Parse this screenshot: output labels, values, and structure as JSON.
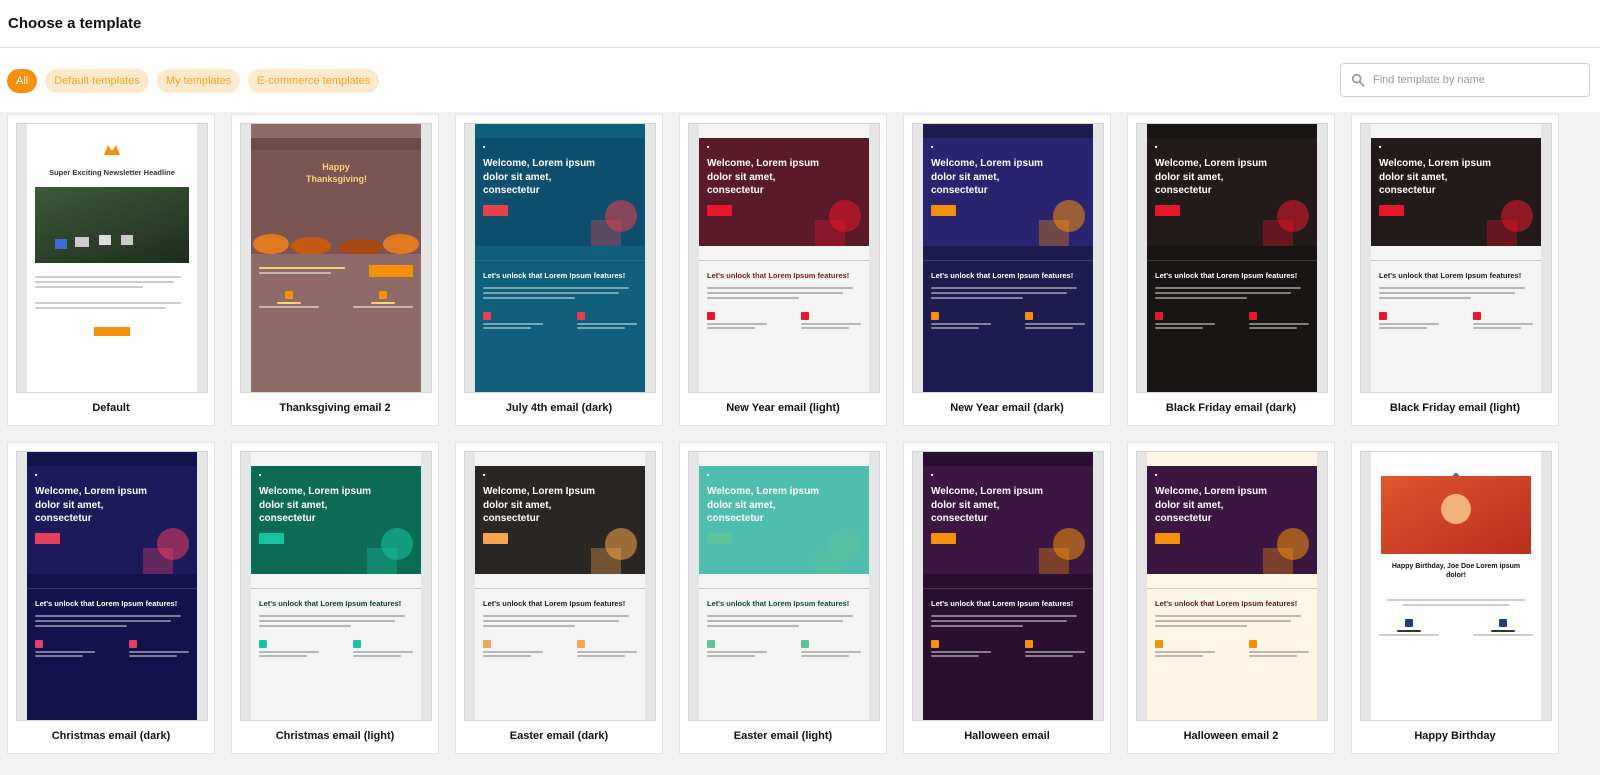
{
  "header": {
    "title": "Choose a template"
  },
  "filters": [
    {
      "label": "All",
      "active": true
    },
    {
      "label": "Default templates",
      "active": false
    },
    {
      "label": "My templates",
      "active": false
    },
    {
      "label": "E-commerce templates",
      "active": false
    }
  ],
  "search": {
    "placeholder": "Find template by name",
    "icon": "search-icon"
  },
  "templates": [
    {
      "name": "Default",
      "style": "default",
      "bg": "#ffffff",
      "hero": "#ffffff",
      "accent": "#f5900a",
      "heading": "Super Exciting Newsletter Headline",
      "text": "#333333"
    },
    {
      "name": "Thanksgiving email 2",
      "style": "thanks",
      "bg": "#8e6b69",
      "hero": "#7a5552",
      "accent": "#f5900a",
      "heading": "Happy Thanksgiving!",
      "text": "#ffd27a"
    },
    {
      "name": "July 4th email (dark)",
      "style": "holiday",
      "bg": "#0f5e7a",
      "hero": "#0f4f6e",
      "accent": "#e8404f",
      "heading": "Welcome, Lorem ipsum dolor sit amet, consectetur",
      "body_heading": "Let's unlock that Lorem Ipsum features!",
      "text": "#ffffff"
    },
    {
      "name": "New Year email (light)",
      "style": "holiday",
      "bg": "#f4f4f4",
      "hero": "#5a1a2a",
      "accent": "#e8172c",
      "heading": "Welcome, Lorem ipsum dolor sit amet, consectetur",
      "body_heading": "Let's unlock that Lorem Ipsum features!",
      "text": "#7a1a24"
    },
    {
      "name": "New Year email (dark)",
      "style": "holiday",
      "bg": "#1e1b4e",
      "hero": "#2a2470",
      "accent": "#f5900a",
      "heading": "Welcome, Lorem ipsum dolor sit amet, consectetur",
      "body_heading": "Let's unlock that Lorem Ipsum features!",
      "text": "#ffffff"
    },
    {
      "name": "Black Friday email (dark)",
      "style": "holiday",
      "bg": "#1a1515",
      "hero": "#231a1a",
      "accent": "#e8172c",
      "heading": "Welcome, Lorem ipsum dolor sit amet, consectetur",
      "body_heading": "Let's unlock that Lorem Ipsum features!",
      "text": "#ffffff"
    },
    {
      "name": "Black Friday email (light)",
      "style": "holiday",
      "bg": "#f4f4f4",
      "hero": "#231a1a",
      "accent": "#e8172c",
      "heading": "Welcome, Lorem ipsum dolor sit amet, consectetur",
      "body_heading": "Let's unlock that Lorem Ipsum features!",
      "text": "#222222"
    },
    {
      "name": "Christmas email (dark)",
      "style": "holiday",
      "bg": "#14124a",
      "hero": "#1d1a5c",
      "accent": "#e8405f",
      "heading": "Welcome, Lorem ipsum dolor sit amet, consectetur",
      "body_heading": "Let's unlock that Lorem Ipsum features!",
      "text": "#ffffff"
    },
    {
      "name": "Christmas email (light)",
      "style": "holiday",
      "bg": "#f4f4f4",
      "hero": "#0d6a55",
      "accent": "#19c2a2",
      "heading": "Welcome, Lorem ipsum dolor sit amet, consectetur",
      "body_heading": "Let's unlock that Lorem Ipsum features!",
      "text": "#0b3d34"
    },
    {
      "name": "Easter email (dark)",
      "style": "holiday",
      "bg": "#f4f4f4",
      "hero": "#2a2623",
      "accent": "#f5a54f",
      "heading": "Welcome, Lorem Ipsum dolor sit amet, consectetur",
      "body_heading": "Let's unlock that Lorem Ipsum features!",
      "text": "#222222"
    },
    {
      "name": "Easter email (light)",
      "style": "holiday",
      "bg": "#f4f4f4",
      "hero": "#4fbdb0",
      "accent": "#5fc39a",
      "heading": "Welcome, Lorem ipsum dolor sit amet, consectetur",
      "body_heading": "Let's unlock that Lorem Ipsum features!",
      "text": "#114a3f"
    },
    {
      "name": "Halloween email",
      "style": "holiday",
      "bg": "#2a0f30",
      "hero": "#3a1640",
      "accent": "#f5900a",
      "heading": "Welcome, Lorem ipsum dolor sit amet, consectetur",
      "body_heading": "Let's unlock that Lorem Ipsum features!",
      "text": "#ffffff"
    },
    {
      "name": "Halloween email 2",
      "style": "holiday",
      "bg": "#fdf5e6",
      "hero": "#3a1640",
      "accent": "#f5900a",
      "heading": "Welcome, Lorem ipsum dolor sit amet, consectetur",
      "body_heading": "Let's unlock that Lorem Ipsum features!",
      "text": "#5a1a24"
    },
    {
      "name": "Happy Birthday",
      "style": "birthday",
      "bg": "#ffffff",
      "hero": "#d24a2a",
      "accent": "#2a6fd6",
      "heading": "Happy Birthday, Joe Doe Lorem ipsum dolor!",
      "text": "#111111"
    }
  ]
}
